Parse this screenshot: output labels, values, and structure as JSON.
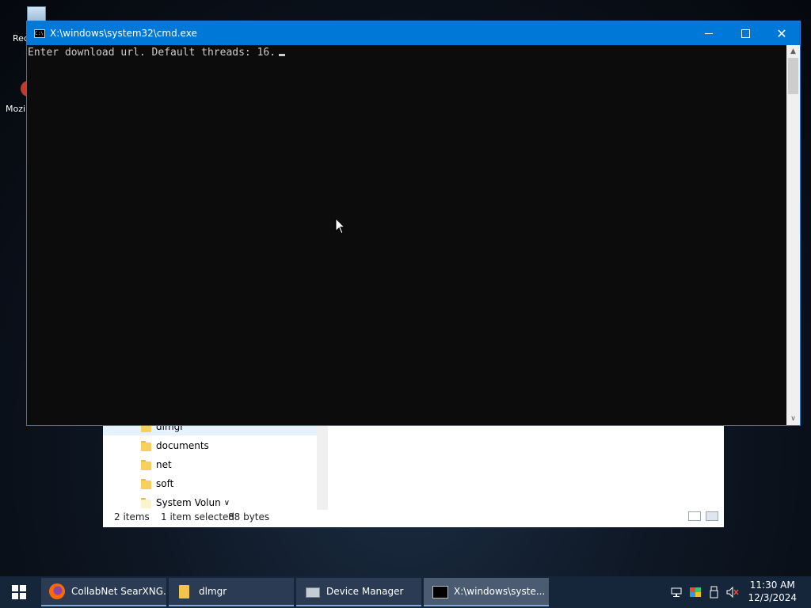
{
  "desktop": {
    "icons": [
      {
        "label": "Rec",
        "icon": "recycle-bin-icon"
      },
      {
        "label": "Mozi",
        "icon": "mozilla-icon"
      }
    ]
  },
  "explorer": {
    "nav_items": [
      {
        "label": "dlmgr",
        "selected": true
      },
      {
        "label": "documents"
      },
      {
        "label": "net"
      },
      {
        "label": "soft"
      },
      {
        "label": "System Volun"
      }
    ],
    "status": {
      "item_count": "2 items",
      "selected": "1 item selected",
      "size": "88 bytes"
    }
  },
  "cmd": {
    "title": "X:\\windows\\system32\\cmd.exe",
    "output": "Enter download url. Default threads: 16.",
    "icon_text": "C:\\"
  },
  "taskbar": {
    "buttons": [
      {
        "label": "CollabNet SearXNG...",
        "icon": "firefox-icon"
      },
      {
        "label": "dlmgr",
        "icon": "folder-icon"
      },
      {
        "label": "Device Manager",
        "icon": "device-manager-icon"
      },
      {
        "label": "X:\\windows\\syste...",
        "icon": "cmd-icon",
        "active": true
      }
    ],
    "clock": {
      "time": "11:30 AM",
      "date": "12/3/2024"
    }
  },
  "colors": {
    "titlebar": "#0078d7",
    "console_bg": "#0c0c0c",
    "console_fg": "#cccccc",
    "taskbar": "#15253a"
  }
}
